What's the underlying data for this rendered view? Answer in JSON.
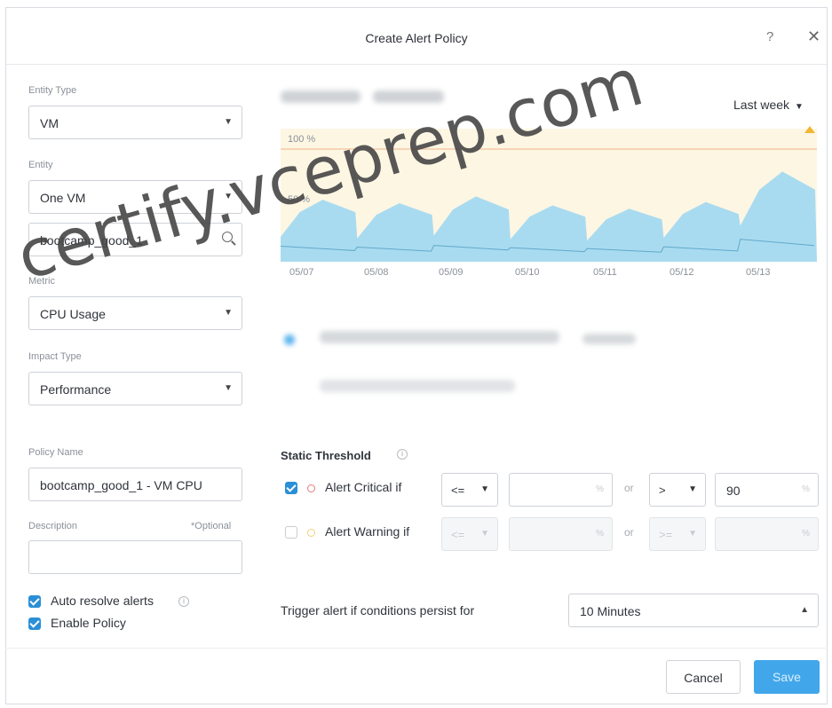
{
  "dialog": {
    "title": "Create Alert Policy"
  },
  "left": {
    "entity_type": {
      "label": "Entity Type",
      "value": "VM"
    },
    "entity": {
      "label": "Entity",
      "value": "One VM",
      "search_value": "bootcamp_good_1"
    },
    "metric": {
      "label": "Metric",
      "value": "CPU Usage"
    },
    "impact_type": {
      "label": "Impact Type",
      "value": "Performance"
    },
    "policy_name": {
      "label": "Policy Name",
      "value": "bootcamp_good_1 - VM CPU"
    },
    "description": {
      "label": "Description",
      "optional": "*Optional",
      "value": ""
    },
    "auto_resolve": {
      "label": "Auto resolve alerts",
      "checked": true
    },
    "enable_policy": {
      "label": "Enable Policy",
      "checked": true
    }
  },
  "chart": {
    "period": "Last week",
    "y_labels": [
      "100 %",
      "50 %"
    ],
    "x_labels": [
      "05/07",
      "05/08",
      "05/09",
      "05/10",
      "05/11",
      "05/12",
      "05/13"
    ]
  },
  "chart_data": {
    "type": "area",
    "x": [
      "05/07",
      "05/08",
      "05/09",
      "05/10",
      "05/11",
      "05/12",
      "05/13"
    ],
    "ylim": [
      0,
      100
    ],
    "series": [
      {
        "values": [
          55,
          52,
          58,
          50,
          47,
          53,
          80
        ]
      }
    ]
  },
  "threshold": {
    "title": "Static Threshold",
    "critical": {
      "label": "Alert Critical if",
      "checked": true,
      "op1": "<=",
      "op2": ">",
      "value2": "90",
      "unit": "%"
    },
    "warning": {
      "label": "Alert Warning if",
      "checked": false,
      "op1": "<=",
      "op2": ">=",
      "unit": "%"
    },
    "or_text": "or"
  },
  "trigger": {
    "label": "Trigger alert if conditions persist for",
    "value": "10 Minutes"
  },
  "buttons": {
    "cancel": "Cancel",
    "save": "Save"
  },
  "watermark": "certify.vceprep.com",
  "colors": {
    "accent": "#2a8fd6",
    "chart_fill": "#a9dbf0",
    "threshold_band": "#fdf6e3"
  }
}
